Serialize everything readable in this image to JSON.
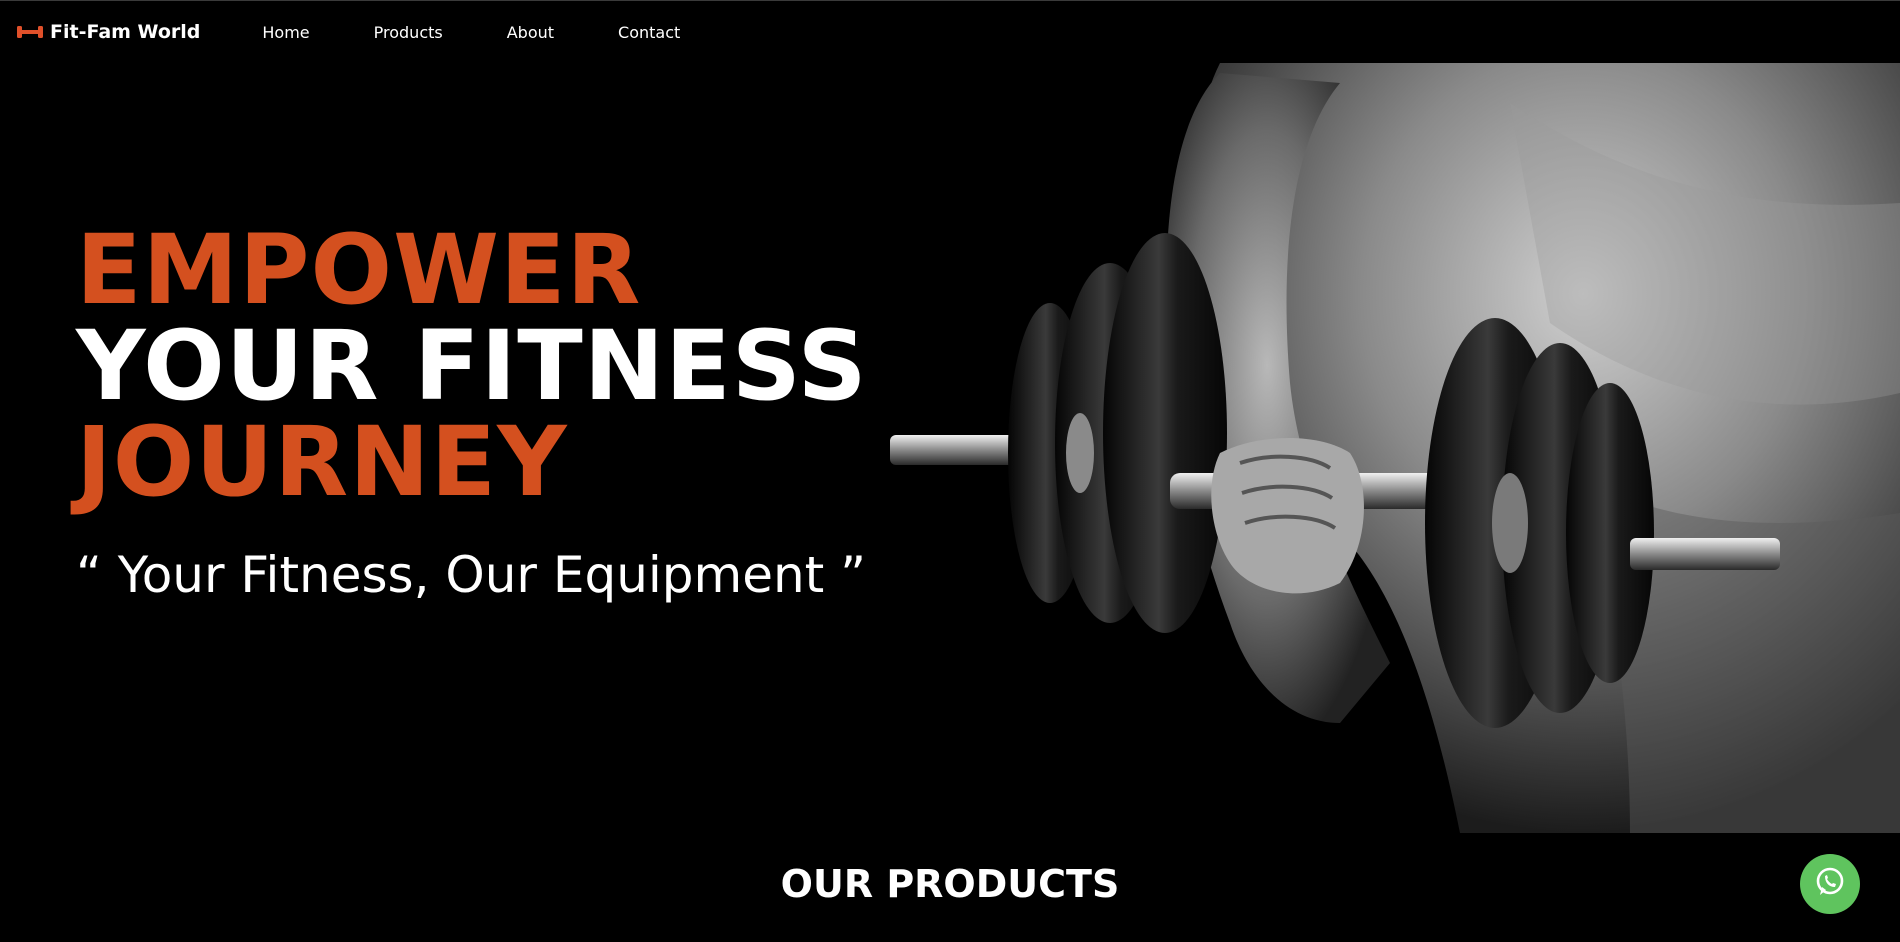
{
  "brand": {
    "name": "Fit-Fam World",
    "icon": "dumbbell-icon",
    "icon_color": "#e0502a"
  },
  "nav": {
    "items": [
      {
        "label": "Home"
      },
      {
        "label": "Products"
      },
      {
        "label": "About"
      },
      {
        "label": "Contact"
      }
    ]
  },
  "hero": {
    "line1": "EMPOWER",
    "line2": "YOUR FITNESS",
    "line3": "JOURNEY",
    "tagline": "“ Your Fitness, Our Equipment ”",
    "accent_color": "#d4501f"
  },
  "products": {
    "title": "OUR PRODUCTS"
  },
  "floating": {
    "icon": "whatsapp-icon",
    "color": "#5fc45e"
  }
}
